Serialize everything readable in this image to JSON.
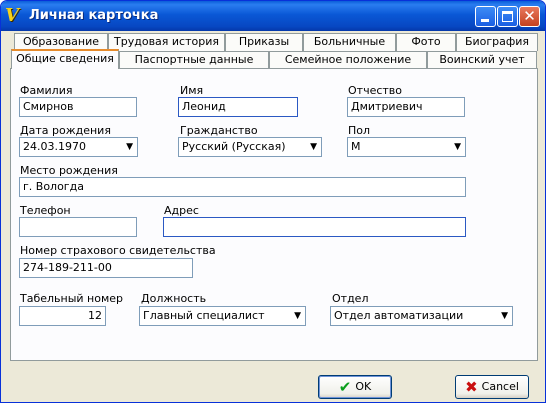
{
  "window": {
    "title": "Личная карточка"
  },
  "tabs_row1": [
    "Образование",
    "Трудовая история",
    "Приказы",
    "Больничные",
    "Фото",
    "Биография"
  ],
  "tabs_row2": [
    "Общие сведения",
    "Паспортные данные",
    "Семейное положение",
    "Воинский учет"
  ],
  "form": {
    "last_name": {
      "label": "Фамилия",
      "value": "Смирнов"
    },
    "first_name": {
      "label": "Имя",
      "value": "Леонид"
    },
    "patronymic": {
      "label": "Отчество",
      "value": "Дмитриевич"
    },
    "birth_date": {
      "label": "Дата рождения",
      "value": "24.03.1970"
    },
    "citizenship": {
      "label": "Гражданство",
      "value": "Русский (Русская)"
    },
    "sex": {
      "label": "Пол",
      "value": "М"
    },
    "birth_place": {
      "label": "Место рождения",
      "value": "г. Вологда"
    },
    "phone": {
      "label": "Телефон",
      "value": ""
    },
    "address": {
      "label": "Адрес",
      "value": ""
    },
    "insurance": {
      "label": "Номер страхового свидетельства",
      "value": "274-189-211-00"
    },
    "tab_number": {
      "label": "Табельный номер",
      "value": "12"
    },
    "position": {
      "label": "Должность",
      "value": "Главный специалист"
    },
    "department": {
      "label": "Отдел",
      "value": "Отдел автоматизации"
    }
  },
  "buttons": {
    "ok": "OK",
    "cancel": "Cancel"
  }
}
